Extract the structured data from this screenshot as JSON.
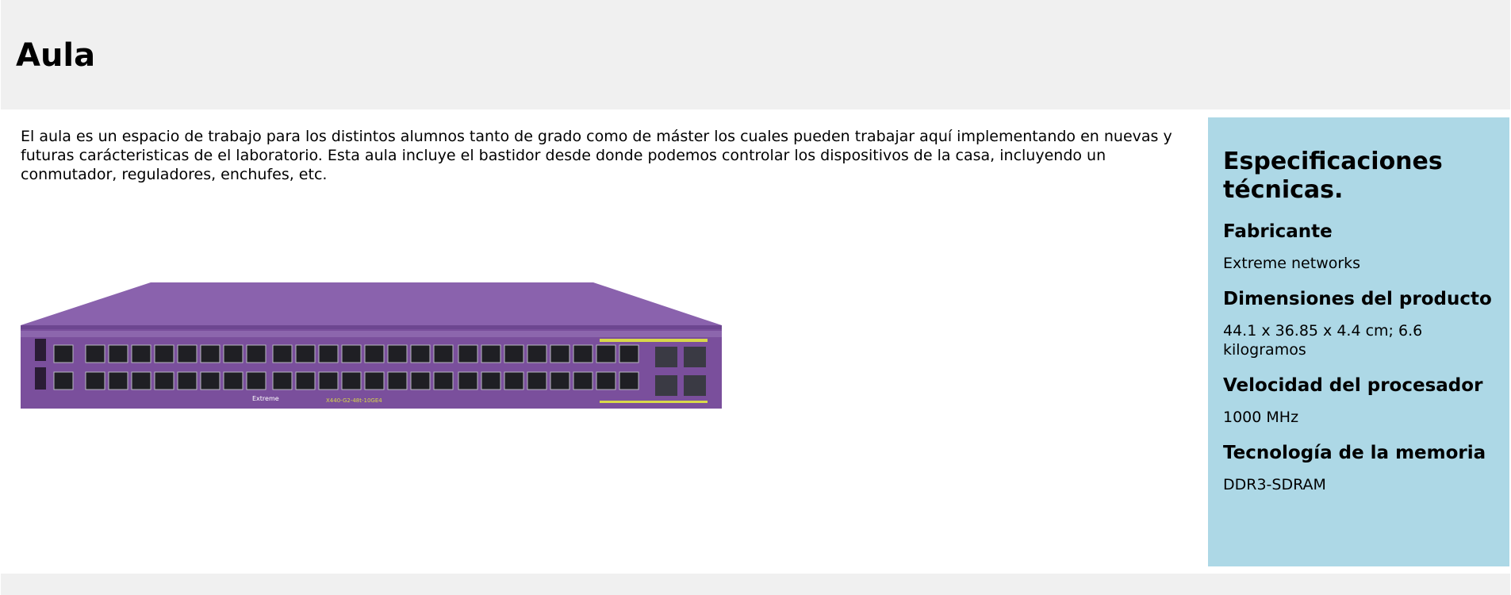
{
  "header": {
    "title": "Aula"
  },
  "main": {
    "description": "El aula es un espacio de trabajo para los distintos alumnos tanto de grado como de máster los cuales pueden trabajar aquí implementando en nuevas y futuras carácteristicas de el laboratorio. Esta aula incluye el bastidor desde donde podemos controlar los dispositivos de la casa, incluyendo un conmutador, reguladores, enchufes, etc.",
    "image": {
      "brand_label": "Extreme",
      "model_label": "X440-G2-48t-10GE4",
      "body_color": "#7a4f9c",
      "accent_color": "#d8d84a"
    }
  },
  "specs": {
    "title": "Especificaciones técnicas.",
    "items": [
      {
        "label": "Fabricante",
        "value": "Extreme networks"
      },
      {
        "label": "Dimensiones del producto",
        "value": "44.1 x 36.85 x 4.4 cm; 6.6 kilogramos"
      },
      {
        "label": "Velocidad del procesador",
        "value": "1000 MHz"
      },
      {
        "label": "Tecnología de la memoria",
        "value": "DDR3-SDRAM"
      }
    ],
    "background_color": "#add8e6"
  },
  "colors": {
    "header_bg": "#f0f0f0",
    "footer_bg": "#f0f0f0"
  }
}
